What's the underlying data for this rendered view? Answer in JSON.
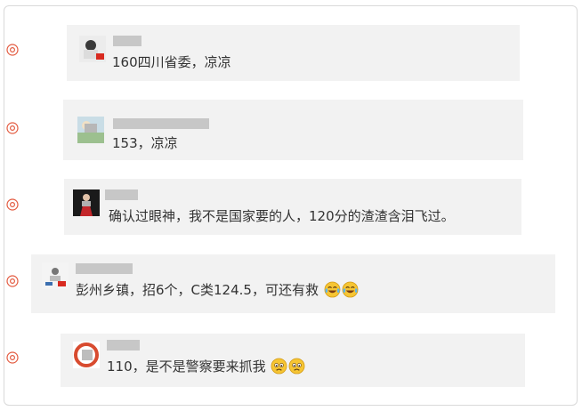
{
  "comments": [
    {
      "text": "160四川省委，凉凉",
      "emoji": []
    },
    {
      "text": "153，凉凉",
      "emoji": []
    },
    {
      "text": "确认过眼神，我不是国家要的人，120分的渣渣含泪飞过。",
      "emoji": []
    },
    {
      "text": "彭州乡镇，招6个，C类124.5，可还有救",
      "emoji": [
        "crying-laughing-emoji",
        "crying-laughing-emoji"
      ]
    },
    {
      "text": "110，是不是警察要来抓我",
      "emoji": [
        "worried-face-emoji",
        "worried-face-emoji"
      ]
    }
  ],
  "colors": {
    "marker": "#e35b40",
    "card_bg": "#f2f2f2",
    "text": "#333333",
    "mask": "#c7c7c7"
  }
}
